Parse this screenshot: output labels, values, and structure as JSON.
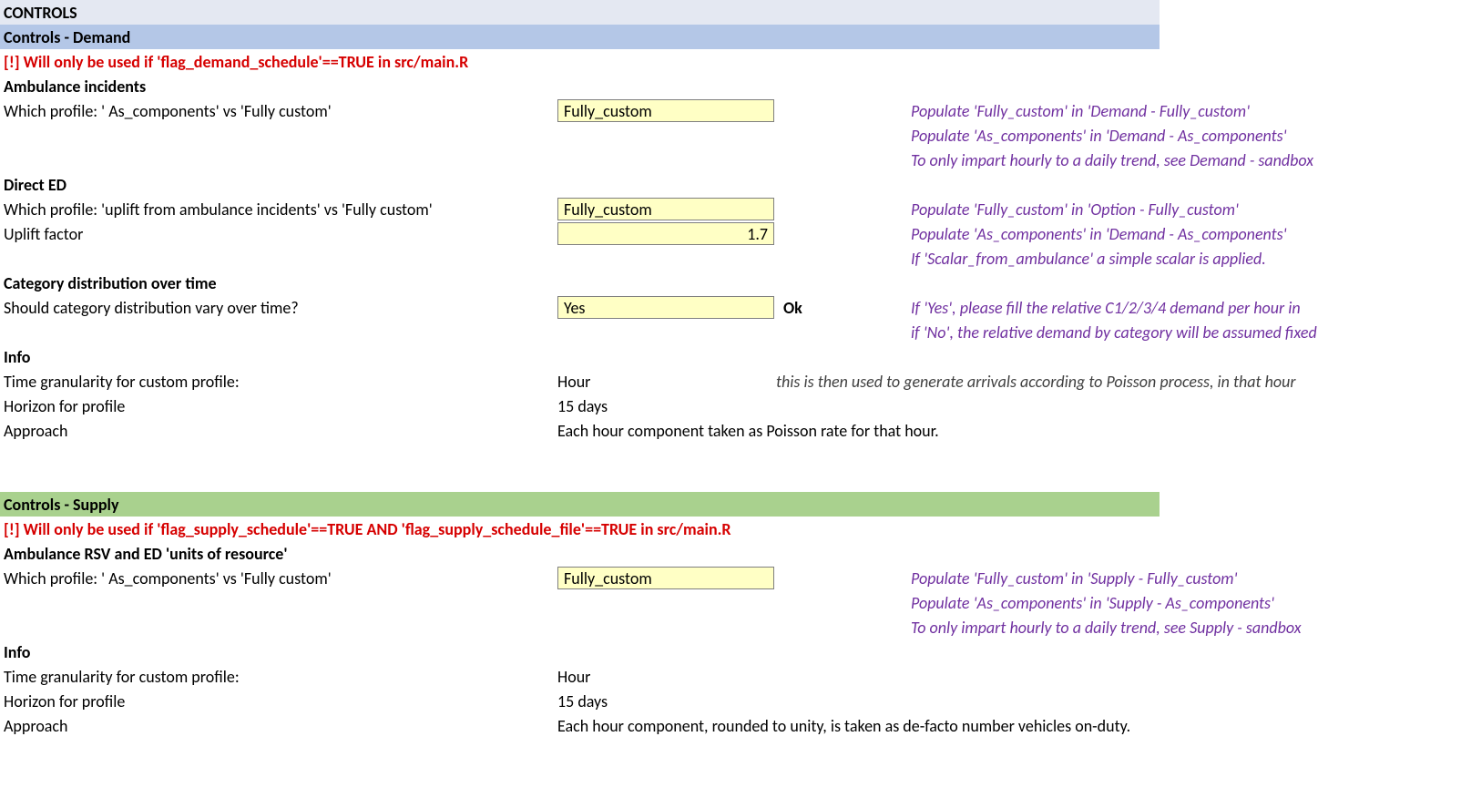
{
  "headers": {
    "controls": "CONTROLS",
    "demand": "Controls - Demand",
    "supply": "Controls - Supply"
  },
  "demand": {
    "warning": "[!] Will only be used if 'flag_demand_schedule'==TRUE in src/main.R",
    "ambulance": {
      "title": "Ambulance incidents",
      "profile_label": "Which profile: ' As_components' vs 'Fully custom'",
      "profile_value": "Fully_custom",
      "notes": [
        "Populate 'Fully_custom' in 'Demand - Fully_custom'",
        "Populate 'As_components' in 'Demand - As_components'",
        "To only impart hourly to a daily trend, see Demand - sandbox"
      ]
    },
    "directed": {
      "title": "Direct ED",
      "profile_label": "Which profile: 'uplift from ambulance incidents' vs 'Fully custom'",
      "profile_value": "Fully_custom",
      "uplift_label": "Uplift factor",
      "uplift_value": "1.7",
      "notes": [
        "Populate 'Fully_custom' in 'Option - Fully_custom'",
        "Populate 'As_components' in 'Demand - As_components'",
        "If 'Scalar_from_ambulance' a simple scalar is applied."
      ]
    },
    "category": {
      "title": "Category distribution over time",
      "label": "Should category distribution vary over time?",
      "value": "Yes",
      "status": "Ok",
      "notes": [
        "If 'Yes', please fill the relative C1/2/3/4 demand per hour in",
        "if 'No', the relative demand by category will be assumed fixed"
      ]
    },
    "info": {
      "title": "Info",
      "granularity_label": "Time granularity for custom profile:",
      "granularity_value": "Hour",
      "granularity_note": "this is then used to generate arrivals according to Poisson process, in that hour",
      "horizon_label": "Horizon for profile",
      "horizon_value": "15 days",
      "approach_label": "Approach",
      "approach_value": "Each hour component taken as Poisson rate for that hour."
    }
  },
  "supply": {
    "warning": "[!] Will only be used if 'flag_supply_schedule'==TRUE AND 'flag_supply_schedule_file'==TRUE in src/main.R",
    "rsv": {
      "title": "Ambulance RSV and ED 'units of resource'",
      "profile_label": "Which profile: ' As_components' vs 'Fully custom'",
      "profile_value": "Fully_custom",
      "notes": [
        "Populate 'Fully_custom' in 'Supply - Fully_custom'",
        "Populate 'As_components' in 'Supply - As_components'",
        "To only impart hourly to a daily trend, see Supply - sandbox"
      ]
    },
    "info": {
      "title": "Info",
      "granularity_label": "Time granularity for custom profile:",
      "granularity_value": "Hour",
      "horizon_label": "Horizon for profile",
      "horizon_value": "15 days",
      "approach_label": "Approach",
      "approach_value": "Each hour component, rounded to unity, is taken as de-facto number vehicles on-duty."
    }
  }
}
